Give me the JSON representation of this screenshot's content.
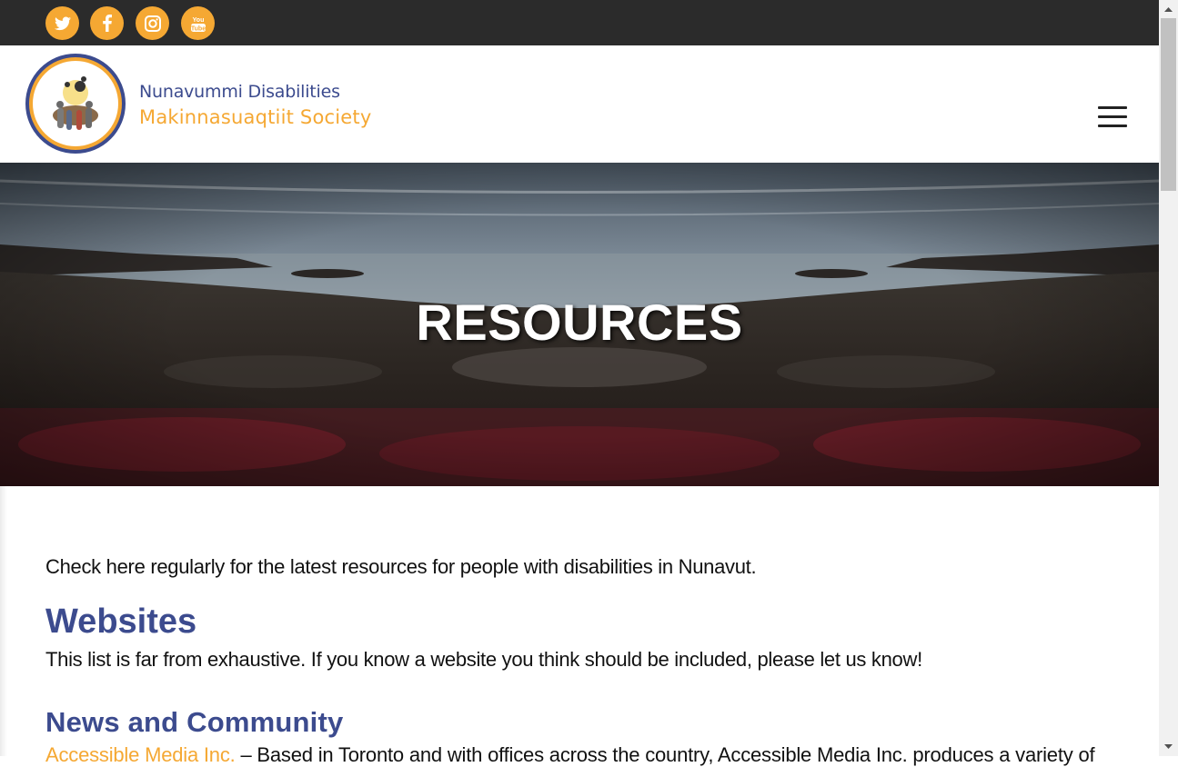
{
  "social": [
    {
      "icon": "twitter-icon"
    },
    {
      "icon": "facebook-icon"
    },
    {
      "icon": "instagram-icon"
    },
    {
      "icon": "youtube-icon",
      "text": "You Tube"
    }
  ],
  "brand": {
    "line1": "Nunavummi Disabilities",
    "line2": "Makinnasuaqtiit Society"
  },
  "hero": {
    "title": "RESOURCES"
  },
  "main": {
    "intro": "Check here regularly for the latest resources for people with disabilities in Nunavut.",
    "websites_heading": "Websites",
    "websites_text": "This list is far from exhaustive. If you know a website you think should be included, please let us know!",
    "news_heading": "News and Community",
    "entry_link": "Accessible Media Inc.",
    "entry_text": " – Based in Toronto and with offices across the country, Accessible Media Inc. produces a variety of"
  },
  "colors": {
    "accent": "#f5a833",
    "heading": "#3c4b8e",
    "topbar": "#2b2b2b"
  }
}
